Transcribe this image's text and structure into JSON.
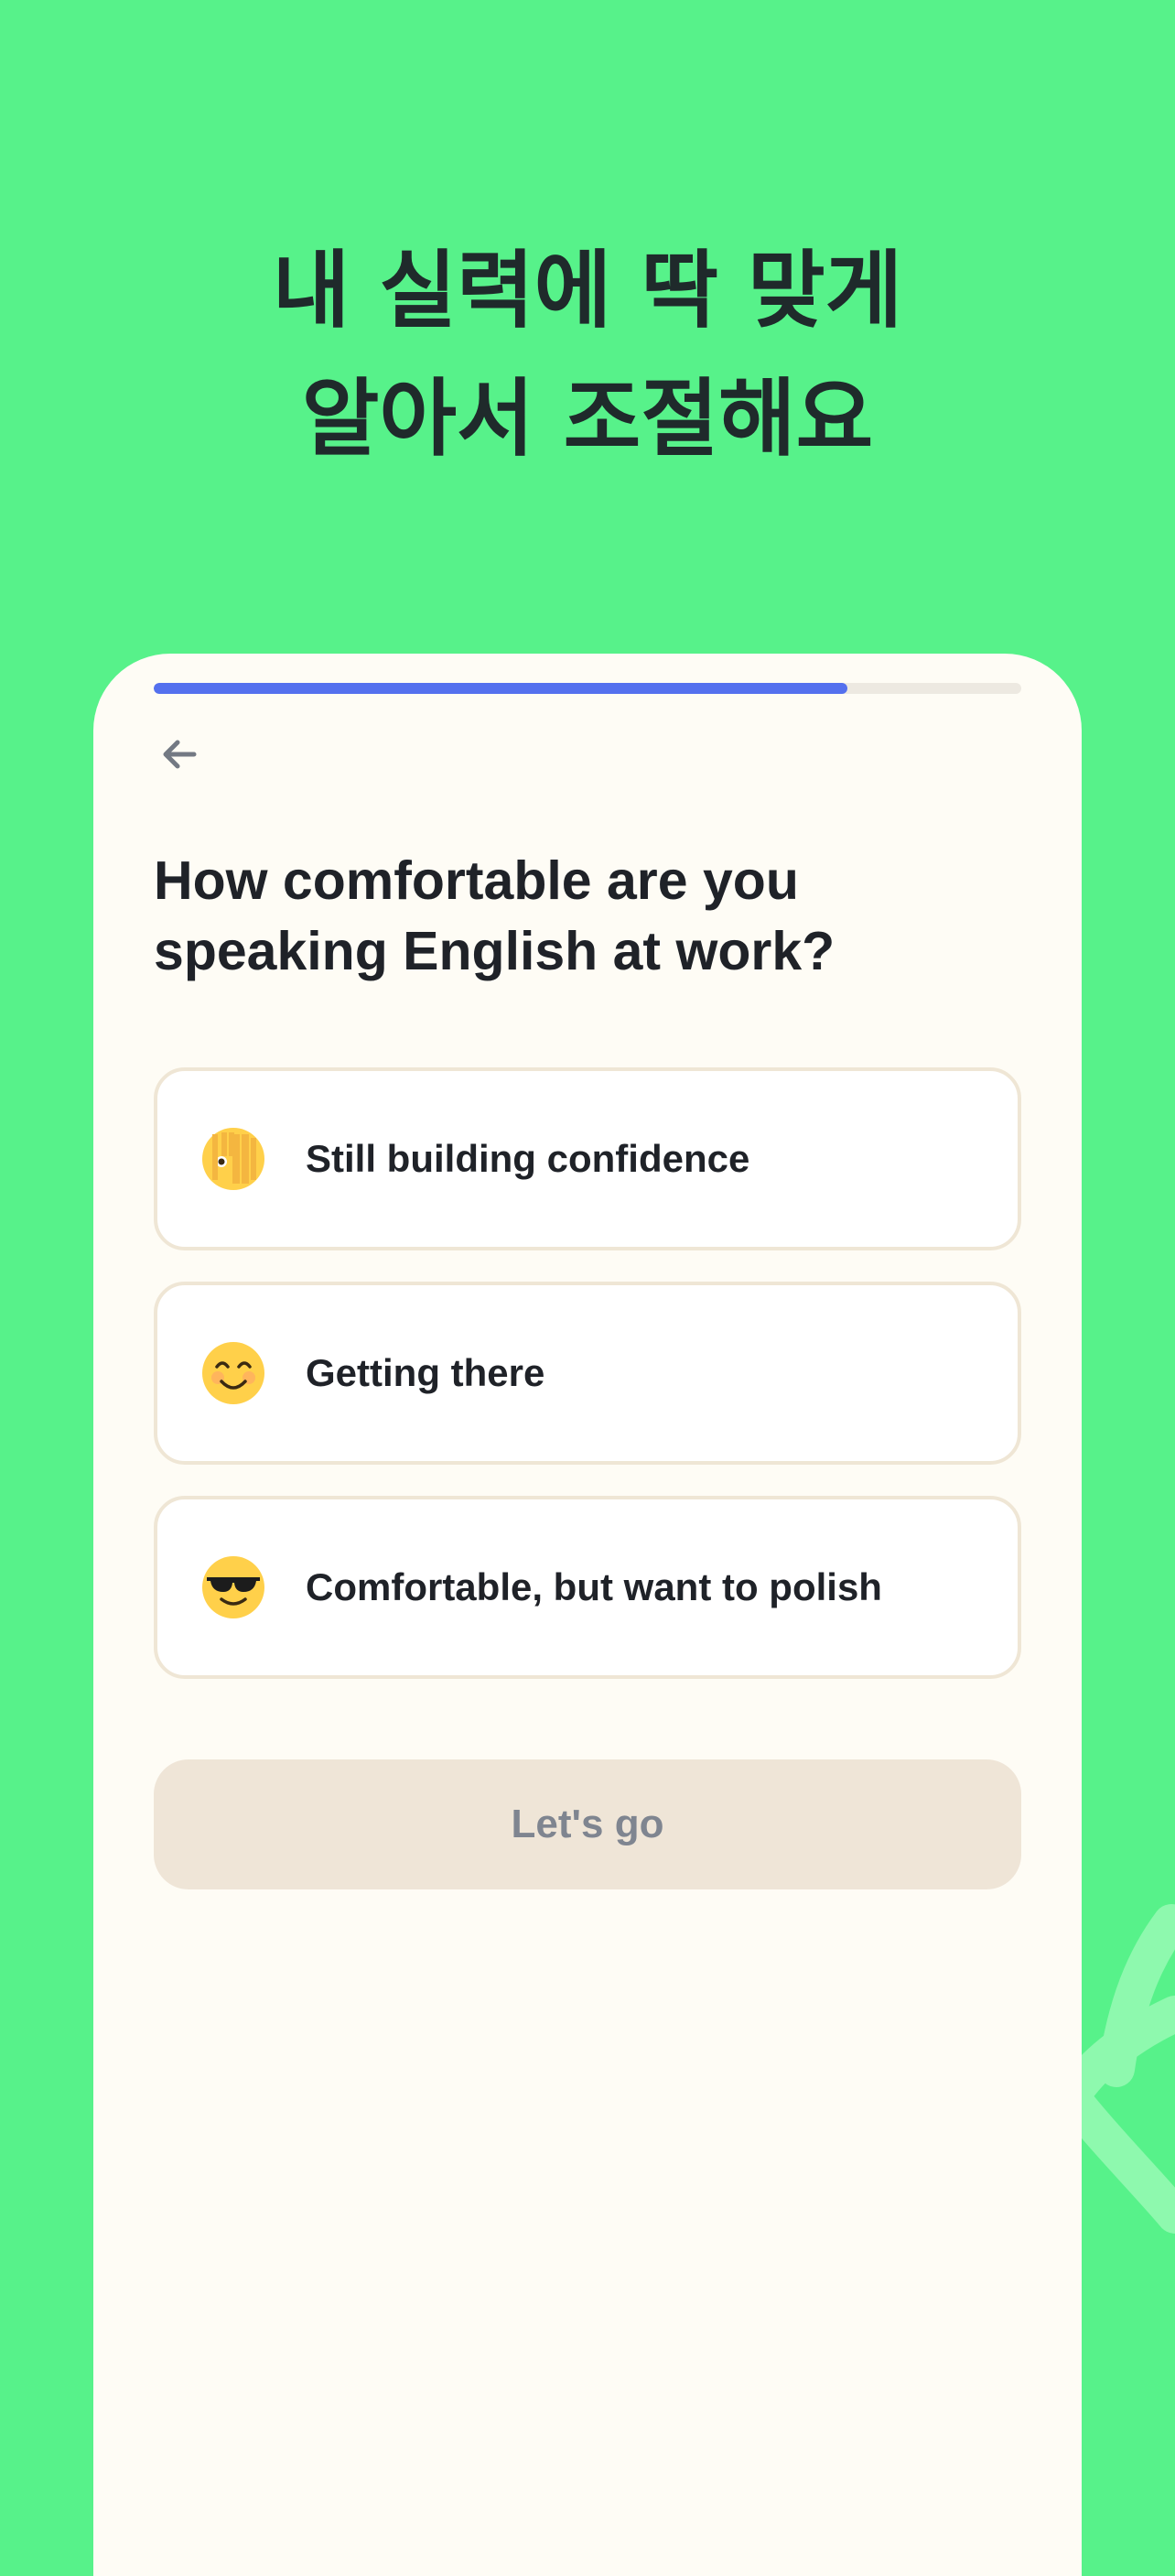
{
  "promo": {
    "headline_line1": "내 실력에 딱 맞게",
    "headline_line2": "알아서 조절해요"
  },
  "survey": {
    "progress": 0.8,
    "back_icon": "arrow-left-icon",
    "question_line1": "How comfortable are you",
    "question_line2": "speaking English at work?",
    "options": [
      {
        "emoji": "face-with-peeking-eye",
        "label": "Still building confidence"
      },
      {
        "emoji": "smiling-face-with-smiling-eyes",
        "label": "Getting there"
      },
      {
        "emoji": "smiling-face-with-sunglasses",
        "label": "Comfortable, but want to polish"
      }
    ],
    "cta_label": "Let's go"
  },
  "colors": {
    "background": "#57f28a",
    "card": "#fefcf5",
    "progress_fill": "#5470ee",
    "progress_track": "#ede9e1",
    "option_border": "#efe6d5",
    "cta_background": "#efe5d7",
    "cta_text": "#7f8590",
    "headline_text": "#1f2a2b"
  }
}
